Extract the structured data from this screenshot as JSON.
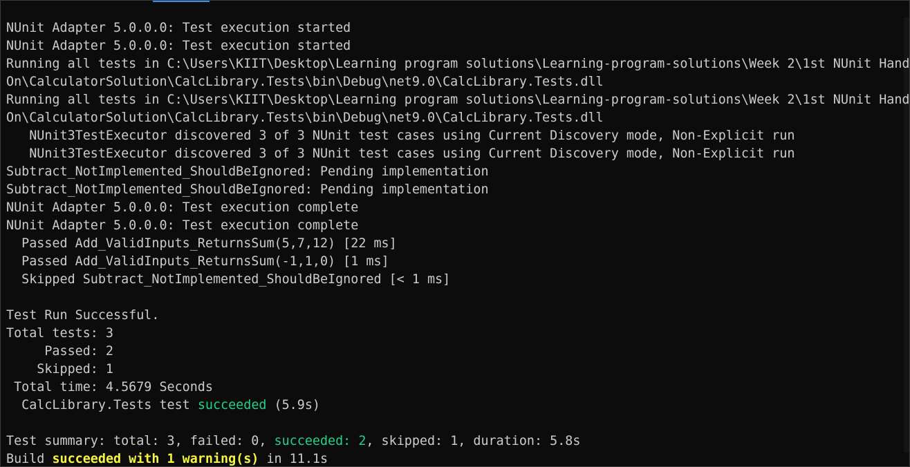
{
  "terminal": {
    "lines": [
      {
        "segments": [
          {
            "text": "NUnit Adapter 5.0.0.0: Test execution started"
          }
        ]
      },
      {
        "segments": [
          {
            "text": "NUnit Adapter 5.0.0.0: Test execution started"
          }
        ]
      },
      {
        "segments": [
          {
            "text": "Running all tests in C:\\Users\\KIIT\\Desktop\\Learning program solutions\\Learning-program-solutions\\Week 2\\1st NUnit Hand"
          }
        ]
      },
      {
        "segments": [
          {
            "text": "On\\CalculatorSolution\\CalcLibrary.Tests\\bin\\Debug\\net9.0\\CalcLibrary.Tests.dll"
          }
        ]
      },
      {
        "segments": [
          {
            "text": "Running all tests in C:\\Users\\KIIT\\Desktop\\Learning program solutions\\Learning-program-solutions\\Week 2\\1st NUnit Hand"
          }
        ]
      },
      {
        "segments": [
          {
            "text": "On\\CalculatorSolution\\CalcLibrary.Tests\\bin\\Debug\\net9.0\\CalcLibrary.Tests.dll"
          }
        ]
      },
      {
        "segments": [
          {
            "text": "   NUnit3TestExecutor discovered 3 of 3 NUnit test cases using Current Discovery mode, Non-Explicit run"
          }
        ]
      },
      {
        "segments": [
          {
            "text": "   NUnit3TestExecutor discovered 3 of 3 NUnit test cases using Current Discovery mode, Non-Explicit run"
          }
        ]
      },
      {
        "segments": [
          {
            "text": "Subtract_NotImplemented_ShouldBeIgnored: Pending implementation"
          }
        ]
      },
      {
        "segments": [
          {
            "text": "Subtract_NotImplemented_ShouldBeIgnored: Pending implementation"
          }
        ]
      },
      {
        "segments": [
          {
            "text": "NUnit Adapter 5.0.0.0: Test execution complete"
          }
        ]
      },
      {
        "segments": [
          {
            "text": "NUnit Adapter 5.0.0.0: Test execution complete"
          }
        ]
      },
      {
        "segments": [
          {
            "text": "  Passed Add_ValidInputs_ReturnsSum(5,7,12) [22 ms]"
          }
        ]
      },
      {
        "segments": [
          {
            "text": "  Passed Add_ValidInputs_ReturnsSum(-1,1,0) [1 ms]"
          }
        ]
      },
      {
        "segments": [
          {
            "text": "  Skipped Subtract_NotImplemented_ShouldBeIgnored [< 1 ms]"
          }
        ]
      },
      {
        "segments": [
          {
            "text": ""
          }
        ]
      },
      {
        "segments": [
          {
            "text": "Test Run Successful."
          }
        ]
      },
      {
        "segments": [
          {
            "text": "Total tests: 3"
          }
        ]
      },
      {
        "segments": [
          {
            "text": "     Passed: 2"
          }
        ]
      },
      {
        "segments": [
          {
            "text": "    Skipped: 1"
          }
        ]
      },
      {
        "segments": [
          {
            "text": " Total time: 4.5679 Seconds"
          }
        ]
      },
      {
        "segments": [
          {
            "text": "  CalcLibrary.Tests test "
          },
          {
            "text": "succeeded",
            "style": "green"
          },
          {
            "text": " (5.9s)"
          }
        ]
      },
      {
        "segments": [
          {
            "text": ""
          }
        ]
      },
      {
        "segments": [
          {
            "text": "Test summary: total: 3, failed: 0, "
          },
          {
            "text": "succeeded: 2",
            "style": "green"
          },
          {
            "text": ", skipped: 1, duration: 5.8s"
          }
        ]
      },
      {
        "segments": [
          {
            "text": "Build "
          },
          {
            "text": "succeeded with 1 warning(s)",
            "style": "yellow"
          },
          {
            "text": " in 11.1s"
          }
        ]
      }
    ]
  },
  "colors": {
    "background": "#0c0c0c",
    "text": "#cccccc",
    "success": "#23d18b",
    "warning": "#f5f543"
  }
}
